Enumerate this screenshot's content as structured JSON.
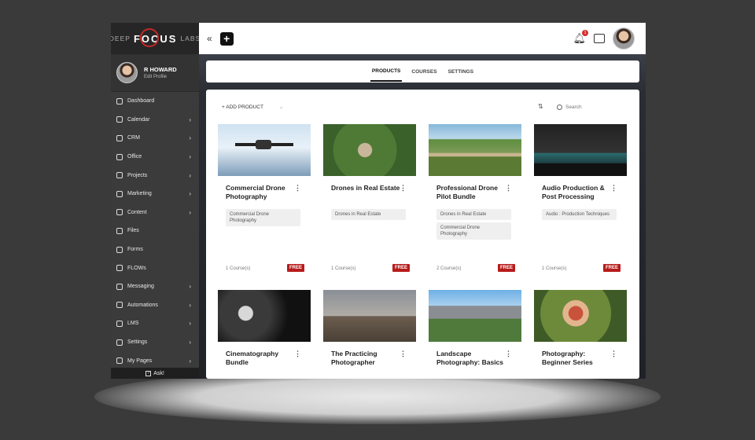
{
  "brand": {
    "deep": "DEEP",
    "focus": "FOCUS",
    "labs": "LABS"
  },
  "user": {
    "name": "R HOWARD",
    "edit": "Edit Profile"
  },
  "sidebar": {
    "items": [
      {
        "label": "Dashboard",
        "icon": "dashboard-icon",
        "chevron": ""
      },
      {
        "label": "Calendar",
        "icon": "calendar-icon",
        "chevron": "›"
      },
      {
        "label": "CRM",
        "icon": "crm-icon",
        "chevron": "›"
      },
      {
        "label": "Office",
        "icon": "office-icon",
        "chevron": "›"
      },
      {
        "label": "Projects",
        "icon": "projects-icon",
        "chevron": "›"
      },
      {
        "label": "Marketing",
        "icon": "marketing-icon",
        "chevron": "›"
      },
      {
        "label": "Content",
        "icon": "content-icon",
        "chevron": "›"
      },
      {
        "label": "Files",
        "icon": "files-icon",
        "chevron": ""
      },
      {
        "label": "Forms",
        "icon": "forms-icon",
        "chevron": ""
      },
      {
        "label": "FLOWs",
        "icon": "flows-icon",
        "chevron": ""
      },
      {
        "label": "Messaging",
        "icon": "messaging-icon",
        "chevron": "›"
      },
      {
        "label": "Automations",
        "icon": "automations-icon",
        "chevron": "›"
      },
      {
        "label": "LMS",
        "icon": "lms-icon",
        "chevron": "›"
      },
      {
        "label": "Settings",
        "icon": "settings-icon",
        "chevron": "›"
      },
      {
        "label": "My Pages",
        "icon": "pages-icon",
        "chevron": "›"
      }
    ],
    "ask": "Ask!"
  },
  "topbar": {
    "collapse": "«",
    "add": "+",
    "notifications": "1"
  },
  "tabs": [
    "PRODUCTS",
    "COURSES",
    "SETTINGS"
  ],
  "toolbar": {
    "add_product": "+ ADD PRODUCT",
    "search_placeholder": "Search"
  },
  "products": [
    {
      "title": "Commercial Drone Photography",
      "tags": [
        "Commercial Drone Photography"
      ],
      "count": "1 Course(s)",
      "price": "FREE"
    },
    {
      "title": "Drones in Real Estate",
      "tags": [
        "Drones in Real Estate"
      ],
      "count": "1 Course(s)",
      "price": "FREE"
    },
    {
      "title": "Professional Drone Pilot Bundle",
      "tags": [
        "Drones in Real Estate",
        "Commercial Drone Photography"
      ],
      "count": "2 Course(s)",
      "price": "FREE"
    },
    {
      "title": "Audio Production & Post Processing",
      "tags": [
        "Audio : Production Techniques"
      ],
      "count": "1 Course(s)",
      "price": "FREE"
    },
    {
      "title": "Cinematography Bundle",
      "tags": [],
      "count": "",
      "price": ""
    },
    {
      "title": "The Practicing Photographer",
      "tags": [],
      "count": "",
      "price": ""
    },
    {
      "title": "Landscape Photography: Basics",
      "tags": [],
      "count": "",
      "price": ""
    },
    {
      "title": "Photography: Beginner Series",
      "tags": [],
      "count": "",
      "price": ""
    }
  ]
}
